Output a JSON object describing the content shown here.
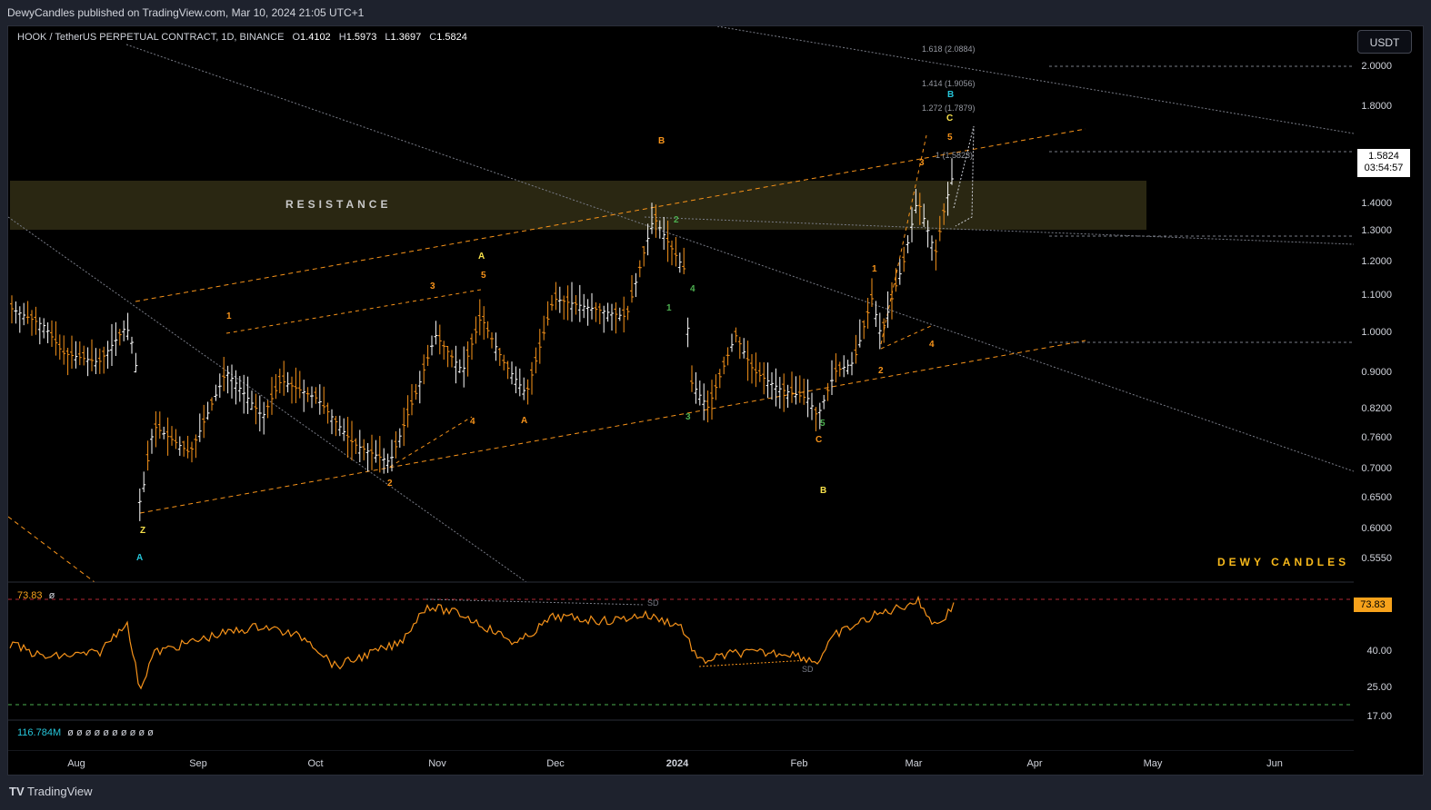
{
  "header": {
    "published_by": "DewyCandles published on TradingView.com, Mar 10, 2024 21:05 UTC+1"
  },
  "symbol": {
    "name": "HOOK / TetherUS PERPETUAL CONTRACT, 1D, BINANCE",
    "o_label": "O",
    "o": "1.4102",
    "h_label": "H",
    "h": "1.5973",
    "l_label": "L",
    "l": "1.3697",
    "c_label": "C",
    "c": "1.5824"
  },
  "currency_button": "USDT",
  "price_axis": [
    "2.0000",
    "1.8000",
    "1.4000",
    "1.3000",
    "1.2000",
    "1.1000",
    "1.0000",
    "0.9000",
    "0.8200",
    "0.7600",
    "0.7000",
    "0.6500",
    "0.6000",
    "0.5550"
  ],
  "price_tag": {
    "price": "1.5824",
    "countdown": "03:54:57"
  },
  "fib_levels": [
    "1.618 (2.0884)",
    "1.414 (1.9056)",
    "1.272 (1.7879)",
    "1 (1.5823)"
  ],
  "resistance_label": "RESISTANCE",
  "watermark": "DEWY CANDLES",
  "rsi": {
    "value": "73.83",
    "value_left": "73.83",
    "marker": "ø",
    "axis": [
      "40.00",
      "25.00",
      "17.00"
    ],
    "divergence_label": "SD"
  },
  "volume": {
    "value": "116.784M",
    "markers": "ø ø ø ø ø ø ø ø ø ø"
  },
  "time_axis": [
    "Aug",
    "Sep",
    "Oct",
    "Nov",
    "Dec",
    "2024",
    "Feb",
    "Mar",
    "Apr",
    "May",
    "Jun"
  ],
  "wave_labels": [
    {
      "text": "Z",
      "color": "#f7e14b"
    },
    {
      "text": "A",
      "color": "#26c6da"
    },
    {
      "text": "1",
      "color": "#f7931a"
    },
    {
      "text": "2",
      "color": "#f7931a"
    },
    {
      "text": "3",
      "color": "#f7931a"
    },
    {
      "text": "4",
      "color": "#f7931a"
    },
    {
      "text": "5",
      "color": "#f7931a"
    },
    {
      "text": "A",
      "color": "#f7e14b"
    },
    {
      "text": "A",
      "color": "#f7931a"
    },
    {
      "text": "B",
      "color": "#f7931a"
    },
    {
      "text": "1",
      "color": "#4caf50"
    },
    {
      "text": "2",
      "color": "#4caf50"
    },
    {
      "text": "3",
      "color": "#4caf50"
    },
    {
      "text": "4",
      "color": "#4caf50"
    },
    {
      "text": "5",
      "color": "#4caf50"
    },
    {
      "text": "C",
      "color": "#f7931a"
    },
    {
      "text": "B",
      "color": "#f7e14b"
    },
    {
      "text": "1",
      "color": "#f7931a"
    },
    {
      "text": "2",
      "color": "#f7931a"
    },
    {
      "text": "3",
      "color": "#f7931a"
    },
    {
      "text": "4",
      "color": "#f7931a"
    },
    {
      "text": "5",
      "color": "#f7931a"
    },
    {
      "text": "C",
      "color": "#f7e14b"
    },
    {
      "text": "B",
      "color": "#26c6da"
    }
  ],
  "colors": {
    "background": "#000000",
    "accent_orange": "#f7931a",
    "price_bar_white": "#ffffff",
    "rsi_line": "#f7931a"
  },
  "footer": {
    "brand": "TradingView"
  }
}
